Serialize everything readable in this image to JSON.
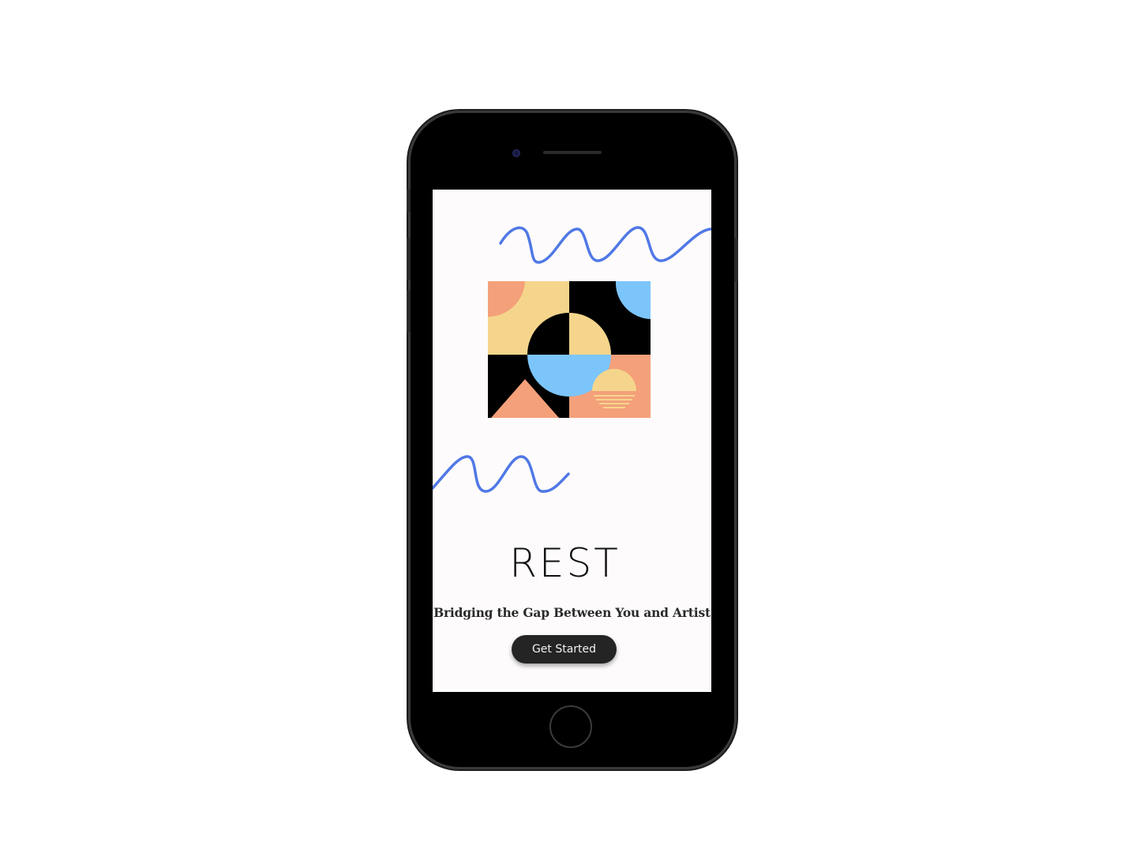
{
  "app": {
    "brand_title": "REST",
    "tagline": "Bridging the Gap Between You and Artist",
    "cta_label": "Get Started"
  },
  "theme": {
    "wave_color": "#5078e6",
    "peach": "#f4a07a",
    "sand": "#f5d58c",
    "sky": "#7cc5fb",
    "ink": "#000000",
    "button_bg": "#242424"
  },
  "icons": {
    "hero": "geometric-art-illustration",
    "decor_top": "squiggle-wave",
    "decor_bottom": "squiggle-wave"
  }
}
